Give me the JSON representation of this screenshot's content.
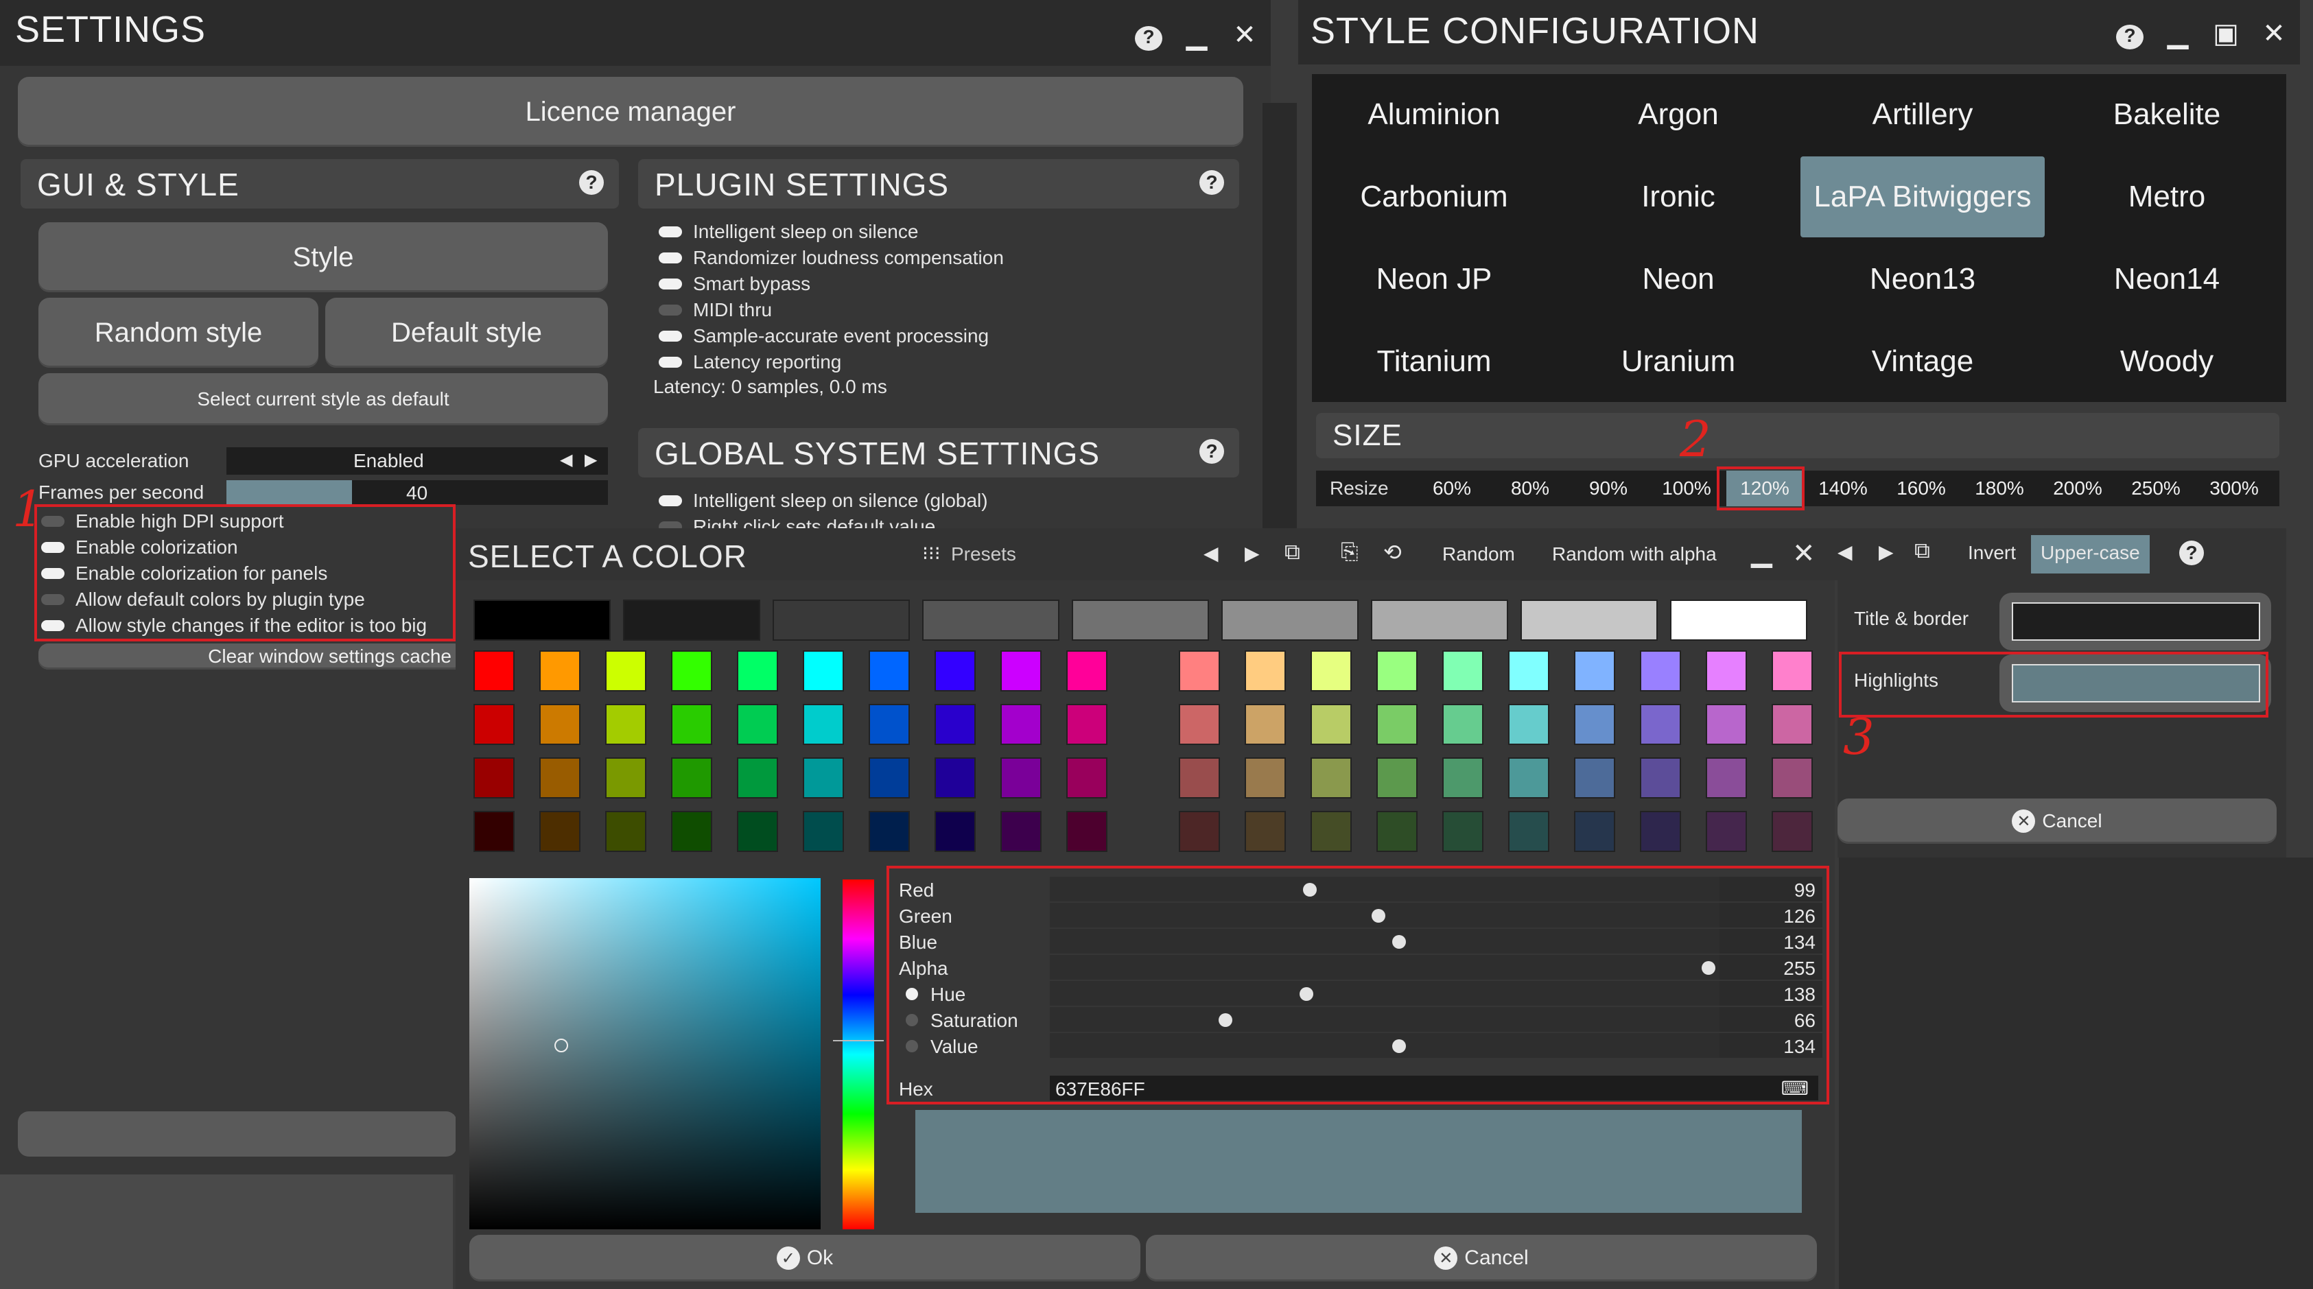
{
  "settings": {
    "title": "SETTINGS",
    "licence_manager": "Licence manager",
    "gui": {
      "heading": "GUI & STYLE",
      "style_button": "Style",
      "random_style": "Random style",
      "default_style": "Default style",
      "select_default": "Select current style as default",
      "gpu_label": "GPU acceleration",
      "gpu_value": "Enabled",
      "fps_label": "Frames per second",
      "fps_value": "40",
      "fps_fraction": 0.33,
      "options": [
        {
          "label": "Enable high DPI support",
          "on": false
        },
        {
          "label": "Enable colorization",
          "on": true
        },
        {
          "label": "Enable colorization for panels",
          "on": true
        },
        {
          "label": "Allow default colors by plugin type",
          "on": false
        },
        {
          "label": "Allow style changes if the editor is too big",
          "on": true
        }
      ],
      "clear_cache": "Clear window settings cache"
    },
    "plugin": {
      "heading": "PLUGIN SETTINGS",
      "options": [
        {
          "label": "Intelligent sleep on silence",
          "on": true
        },
        {
          "label": "Randomizer loudness compensation",
          "on": true
        },
        {
          "label": "Smart bypass",
          "on": true
        },
        {
          "label": "MIDI thru",
          "on": false
        },
        {
          "label": "Sample-accurate event processing",
          "on": true
        },
        {
          "label": "Latency reporting",
          "on": true
        }
      ],
      "latency_text": "Latency: 0 samples, 0.0 ms"
    },
    "global": {
      "heading": "GLOBAL SYSTEM SETTINGS",
      "options": [
        {
          "label": "Intelligent sleep on silence (global)",
          "on": true
        },
        {
          "label": "Right click sets default value",
          "on": false
        }
      ]
    }
  },
  "style_config": {
    "title": "STYLE CONFIGURATION",
    "styles": [
      "Aluminion",
      "Argon",
      "Artillery",
      "Bakelite",
      "Carbonium",
      "Ironic",
      "LaPA Bitwiggers",
      "Metro",
      "Neon JP",
      "Neon",
      "Neon13",
      "Neon14",
      "Titanium",
      "Uranium",
      "Vintage",
      "Woody"
    ],
    "selected_style": "LaPA Bitwiggers",
    "size_heading": "SIZE",
    "resize_label": "Resize",
    "sizes": [
      "60%",
      "80%",
      "90%",
      "100%",
      "120%",
      "140%",
      "160%",
      "180%",
      "200%",
      "250%",
      "300%"
    ],
    "selected_size": "120%",
    "toolbar": {
      "invert": "Invert",
      "upper_case": "Upper-case"
    },
    "title_border_label": "Title & border",
    "highlights_label": "Highlights",
    "cancel": "Cancel"
  },
  "color_dialog": {
    "title": "SELECT A COLOR",
    "presets": "Presets",
    "random": "Random",
    "random_alpha": "Random with alpha",
    "grays": [
      "#000000",
      "#1c1c1c",
      "#393939",
      "#555555",
      "#717171",
      "#8e8e8e",
      "#aaaaaa",
      "#c6c6c6",
      "#ffffff"
    ],
    "palette_left": [
      [
        "#ff0000",
        "#ff9900",
        "#ccff00",
        "#33ff00",
        "#00ff66",
        "#00ffff",
        "#0066ff",
        "#3300ff",
        "#cc00ff",
        "#ff0099"
      ],
      [
        "#cc0000",
        "#cc7a00",
        "#a3cc00",
        "#29cc00",
        "#00cc52",
        "#00cccc",
        "#0052cc",
        "#2900cc",
        "#a300cc",
        "#cc007a"
      ],
      [
        "#990000",
        "#995c00",
        "#7a9900",
        "#1f9900",
        "#00993d",
        "#009999",
        "#003d99",
        "#1f0099",
        "#7a0099",
        "#99005c"
      ],
      [
        "#330000",
        "#4d2e00",
        "#3d4d00",
        "#0f4d00",
        "#004d1f",
        "#004d4d",
        "#001f4d",
        "#0f004d",
        "#3d004d",
        "#4d002e"
      ]
    ],
    "palette_right": [
      [
        "#ff8080",
        "#ffcc80",
        "#e6ff80",
        "#99ff80",
        "#80ffb3",
        "#80ffff",
        "#80b3ff",
        "#9980ff",
        "#e680ff",
        "#ff80cc"
      ],
      [
        "#cc6666",
        "#cca366",
        "#b8cc66",
        "#7acc66",
        "#66cc8f",
        "#66cccc",
        "#668fcc",
        "#7a66cc",
        "#b866cc",
        "#cc66a3"
      ],
      [
        "#994d4d",
        "#997a4d",
        "#8a994d",
        "#5c994d",
        "#4d996b",
        "#4d9999",
        "#4d6b99",
        "#5c4d99",
        "#8a4d99",
        "#994d7a"
      ],
      [
        "#4d2626",
        "#4d3d26",
        "#454d26",
        "#2e4d26",
        "#264d36",
        "#264d4d",
        "#26364d",
        "#2e264d",
        "#45264d",
        "#4d263d"
      ]
    ],
    "sliders": [
      {
        "name": "Red",
        "value": 99,
        "max": 255
      },
      {
        "name": "Green",
        "value": 126,
        "max": 255
      },
      {
        "name": "Blue",
        "value": 134,
        "max": 255
      },
      {
        "name": "Alpha",
        "value": 255,
        "max": 255
      },
      {
        "name": "Hue",
        "value": 138,
        "max": 360,
        "radio": true,
        "selected": true
      },
      {
        "name": "Saturation",
        "value": 66,
        "max": 255,
        "radio": true,
        "selected": false
      },
      {
        "name": "Value",
        "value": 134,
        "max": 255,
        "radio": true,
        "selected": false
      }
    ],
    "hex_label": "Hex",
    "hex_value": "637E86FF",
    "preview_color": "#637e86",
    "ok": "Ok",
    "cancel": "Cancel"
  },
  "annotations": [
    "1",
    "2",
    "3"
  ],
  "colors": {
    "accent": "#6e8b95",
    "highlight_box": "#d81e24"
  }
}
